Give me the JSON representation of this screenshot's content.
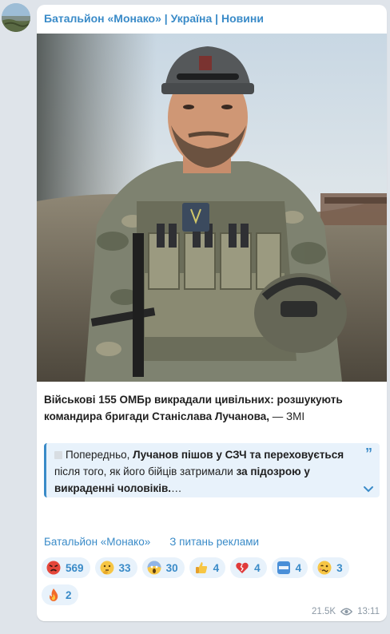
{
  "channel": {
    "title": "Батальйон «Монако» | Україна | Новини"
  },
  "post": {
    "headline": "Військові 155 ОМБр викрадали цивільних: розшукують командира бригади Станіслава Лучанова,",
    "source": " — ЗМІ",
    "quote": {
      "part1": "Попередньо, ",
      "part2_bold": "Лучанов пішов у СЗЧ та переховується",
      "part3": " після того, як його бійців затримали ",
      "part4_bold": "за підозрою у викраденні чоловіків.",
      "ellipsis": "…"
    },
    "links": {
      "channel_link": "Батальйон «Монако»",
      "ads_link": "З питань реклами"
    }
  },
  "reactions": [
    {
      "icon": "enraged-face-icon",
      "count": "569"
    },
    {
      "icon": "thinking-face-icon",
      "count": "33"
    },
    {
      "icon": "screaming-face-icon",
      "count": "30"
    },
    {
      "icon": "thumbs-up-icon",
      "count": "4"
    },
    {
      "icon": "broken-heart-icon",
      "count": "4"
    },
    {
      "icon": "cool-button-icon",
      "count": "4"
    },
    {
      "icon": "woozy-face-icon",
      "count": "3"
    },
    {
      "icon": "fire-icon",
      "count": "2"
    }
  ],
  "meta": {
    "views": "21.5K",
    "time": "13:11"
  },
  "colors": {
    "accent": "#3a8bc8",
    "background": "#dfe4ea",
    "quote_bg": "#e8f2fb"
  }
}
